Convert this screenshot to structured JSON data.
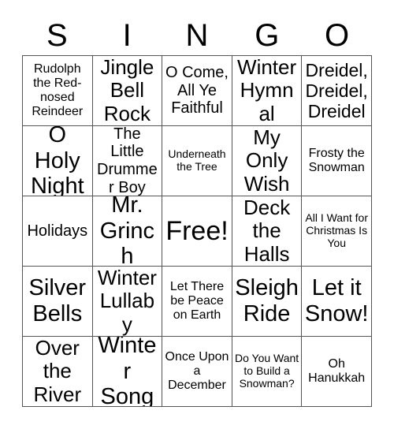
{
  "card": {
    "title_letters": [
      "S",
      "I",
      "N",
      "G",
      "O"
    ],
    "columns": 5,
    "rows": 5,
    "free_space_label": "Free!",
    "grid_line_color": "#555555",
    "background_color": "#ffffff",
    "text_color": "#000000",
    "cells": [
      [
        "Rudolph the Red-nosed Reindeer",
        "Jingle Bell Rock",
        "O Come, All Ye Faithful",
        "Winter Hymnal",
        "Dreidel, Dreidel, Dreidel"
      ],
      [
        "O Holy Night",
        "The Little Drummer Boy",
        "Underneath the Tree",
        "My Only Wish",
        "Frosty the Snowman"
      ],
      [
        "Holidays",
        "Mr. Grinch",
        "Free!",
        "Deck the Halls",
        "All I Want for Christmas Is You"
      ],
      [
        "Silver Bells",
        "Winter Lullaby",
        "Let There be Peace on Earth",
        "Sleigh Ride",
        "Let it Snow!"
      ],
      [
        "Over the River",
        "Winter Song",
        "Once Upon a December",
        "Do You Want to Build a Snowman?",
        "Oh Hanukkah"
      ]
    ]
  }
}
